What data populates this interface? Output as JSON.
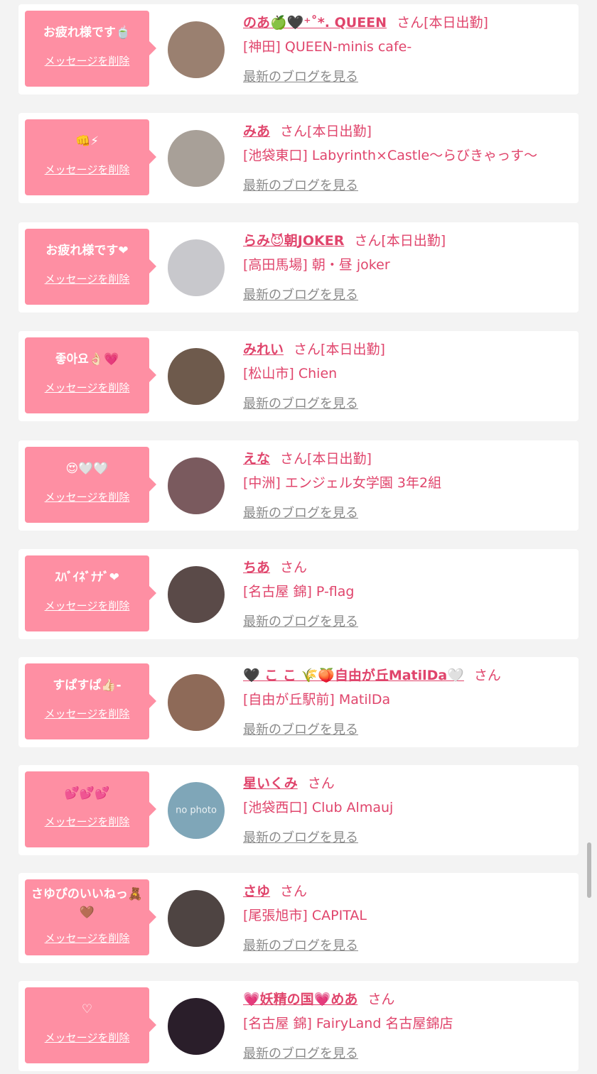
{
  "colors": {
    "accent": "#e0456c",
    "bubble": "#fe8fa3",
    "background": "#f3f3f3",
    "card": "#ffffff",
    "muted_link": "#8a8a8a"
  },
  "delete_label": "メッセージを削除",
  "blog_label": "最新のブログを見る",
  "honorific": "さん",
  "messages": [
    {
      "bubble_text": "お疲れ様です🍵",
      "name": "のあ🍏🖤⁺˚*. QUEEN",
      "status": "[本日出勤]",
      "shop": "[神田] QUEEN-minis cafe-",
      "avatar_color": "#9a8070"
    },
    {
      "bubble_text": "👊⚡",
      "name": "みあ",
      "status": "[本日出勤]",
      "shop": "[池袋東口] Labyrinth×Castle〜らびきゃっす〜",
      "avatar_color": "#a8a098"
    },
    {
      "bubble_text": "お疲れ様です❤",
      "name": "らみ😈朝JOKER",
      "status": "[本日出勤]",
      "shop": "[高田馬場] 朝・昼 joker",
      "avatar_color": "#c8c8cc"
    },
    {
      "bubble_text": "좋아요👌🏻💗",
      "name": "みれい",
      "status": "[本日出勤]",
      "shop": "[松山市] Chien",
      "avatar_color": "#6e5a4c"
    },
    {
      "bubble_text": "😍🤍🤍",
      "name": "えな",
      "status": "[本日出勤]",
      "shop": "[中洲] エンジェル女学園 3年2組",
      "avatar_color": "#7a5a5e"
    },
    {
      "bubble_text": "ｽﾊﾞｲﾈﾞﾅﾅﾞ❤",
      "name": "ちあ",
      "status": "",
      "shop": "[名古屋 錦] P-flag",
      "avatar_color": "#5a4a48"
    },
    {
      "bubble_text": "すぱすぱ👍🏻-",
      "name": "🖤 こ こ 🌾🍑自由が丘MatilDa🤍",
      "status": "",
      "shop": "[自由が丘駅前] MatilDa",
      "avatar_color": "#8e6a58"
    },
    {
      "bubble_text": "💕💕💕",
      "name": "星いくみ",
      "status": "",
      "shop": "[池袋西口] Club Almauj",
      "avatar_color": "#7fa6b8",
      "avatar_text": "no photo"
    },
    {
      "bubble_text": "さゆぴのいいねっ🧸🤎",
      "name": "さゆ",
      "status": "",
      "shop": "[尾張旭市] CAPITAL",
      "avatar_color": "#4e4442",
      "tall": true
    },
    {
      "bubble_text": "♡",
      "name": "💗妖精の国💗めあ",
      "status": "",
      "shop": "[名古屋 錦] FairyLand 名古屋錦店",
      "avatar_color": "#2a1e2a"
    }
  ]
}
